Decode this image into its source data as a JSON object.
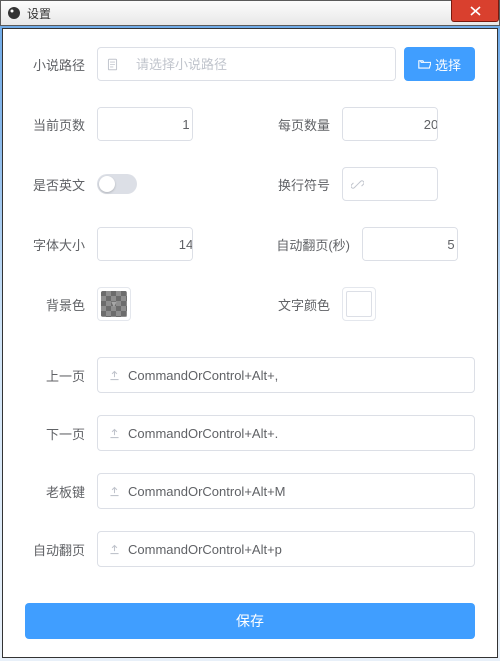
{
  "window": {
    "title": "设置"
  },
  "path": {
    "label": "小说路径",
    "placeholder": "请选择小说路径",
    "select_btn": "选择"
  },
  "page": {
    "current_label": "当前页数",
    "current_value": "1",
    "size_label": "每页数量",
    "size_value": "20"
  },
  "lang": {
    "english_label": "是否英文",
    "linebreak_label": "换行符号"
  },
  "font": {
    "size_label": "字体大小",
    "size_value": "14",
    "autoflip_label": "自动翻页(秒)",
    "autoflip_value": "5"
  },
  "color": {
    "bg_label": "背景色",
    "text_label": "文字颜色"
  },
  "hotkeys": {
    "prev": {
      "label": "上一页",
      "value": "CommandOrControl+Alt+,"
    },
    "next": {
      "label": "下一页",
      "value": "CommandOrControl+Alt+."
    },
    "boss": {
      "label": "老板键",
      "value": "CommandOrControl+Alt+M"
    },
    "auto": {
      "label": "自动翻页",
      "value": "CommandOrControl+Alt+p"
    }
  },
  "save_label": "保存"
}
